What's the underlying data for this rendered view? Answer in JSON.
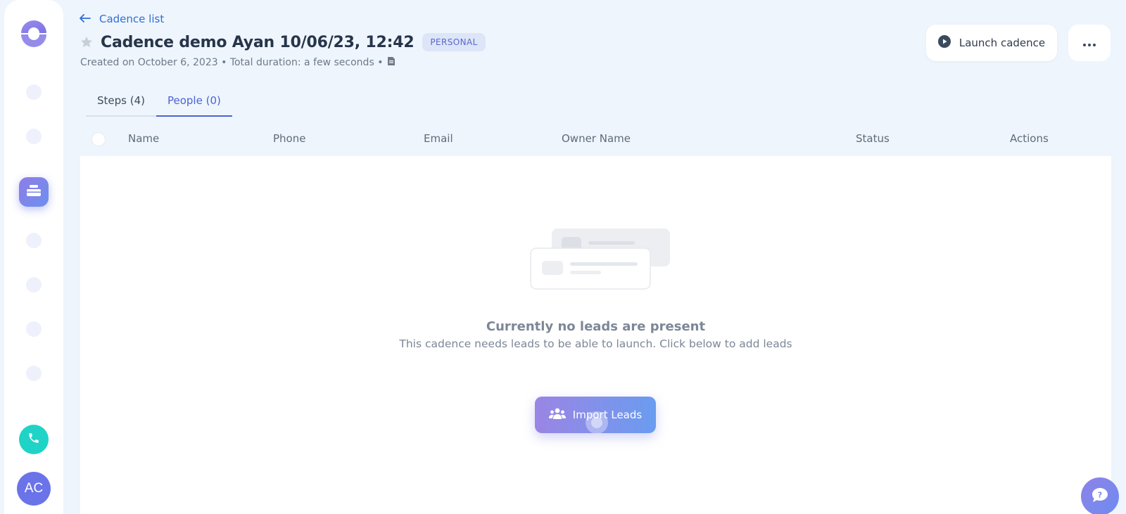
{
  "sidebar": {
    "nav_items": [
      "nav-item-1",
      "nav-item-2",
      "nav-item-cadences",
      "nav-item-4",
      "nav-item-5",
      "nav-item-6",
      "nav-item-7"
    ],
    "active_item": "cadences",
    "avatar_initials": "AC",
    "brand_color": "#8f7de6",
    "phone_color": "#1fd3c7"
  },
  "header": {
    "back_label": "Cadence list",
    "title": "Cadence demo Ayan 10/06/23, 12:42",
    "badge": "PERSONAL",
    "meta": "Created on October 6, 2023 • Total duration: a few seconds •",
    "launch_label": "Launch cadence"
  },
  "tabs": [
    {
      "label": "Steps (4)",
      "active": false
    },
    {
      "label": "People (0)",
      "active": true
    }
  ],
  "table": {
    "columns": [
      "Name",
      "Phone",
      "Email",
      "Owner Name",
      "Status",
      "Actions"
    ]
  },
  "empty_state": {
    "title": "Currently no leads are present",
    "subtitle": "This cadence needs leads to be able to launch. Click below to add leads",
    "button_label": "Import Leads"
  },
  "icons": {
    "back": "arrow-left-icon",
    "star": "star-icon",
    "meta": "document-icon",
    "launch": "play-circle-icon",
    "more": "ellipsis-icon",
    "import": "users-icon",
    "help": "help-chat-icon"
  }
}
